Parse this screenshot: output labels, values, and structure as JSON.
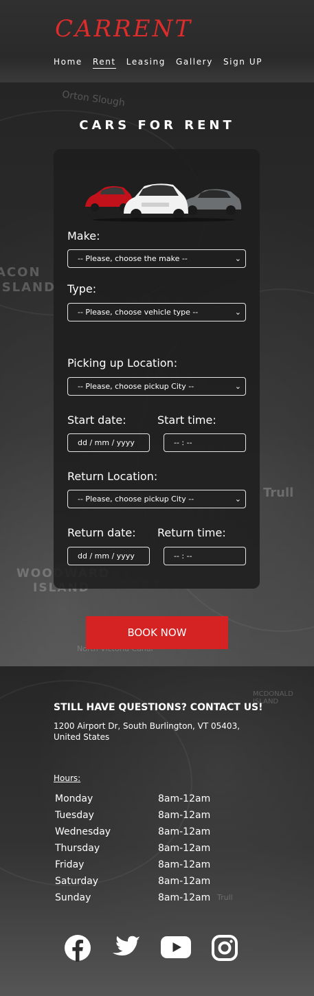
{
  "brand": {
    "logo": "CARRENT",
    "accent": "#d52222"
  },
  "nav": {
    "items": [
      "Home",
      "Rent",
      "Leasing",
      "Gallery",
      "Sign UP"
    ],
    "active": "Rent"
  },
  "page": {
    "title": "CARS FOR RENT"
  },
  "form": {
    "make_label": "Make:",
    "make_placeholder": "-- Please, choose the make --",
    "type_label": "Type:",
    "type_placeholder": "-- Please, choose vehicle type --",
    "pickup_label": "Picking up Location:",
    "pickup_placeholder": "-- Please, choose pickup City --",
    "start_date_label": "Start date:",
    "start_time_label": "Start time:",
    "start_date_value": "dd / mm / yyyy",
    "start_time_value": "-- : --",
    "return_label": "Return Location:",
    "return_placeholder": "-- Please, choose pickup City --",
    "return_date_label": "Return date:",
    "return_time_label": "Return time:",
    "return_date_value": "dd / mm / yyyy",
    "return_time_value": "-- : --",
    "submit_label": "BOOK NOW"
  },
  "map_labels": [
    "ACON",
    "ISLAND",
    "WOODWARD",
    "ISLAND",
    "Trull",
    "North Victoria Canal",
    "Orton Slough",
    "MCDONALD",
    "ISLAND",
    "Trull"
  ],
  "footer": {
    "contact_title": "STILL HAVE QUESTIONS? CONTACT US!",
    "address": "1200 Airport Dr, South Burlington, VT 05403, United States",
    "hours_title": "Hours:",
    "hours": [
      {
        "day": "Monday",
        "time": "8am-12am"
      },
      {
        "day": "Tuesday",
        "time": "8am-12am"
      },
      {
        "day": "Wednesday",
        "time": "8am-12am"
      },
      {
        "day": "Thursday",
        "time": "8am-12am"
      },
      {
        "day": "Friday",
        "time": "8am-12am"
      },
      {
        "day": "Saturday",
        "time": "8am-12am"
      },
      {
        "day": "Sunday",
        "time": "8am-12am"
      }
    ],
    "social_icons": [
      "facebook-icon",
      "twitter-icon",
      "youtube-icon",
      "instagram-icon"
    ]
  }
}
